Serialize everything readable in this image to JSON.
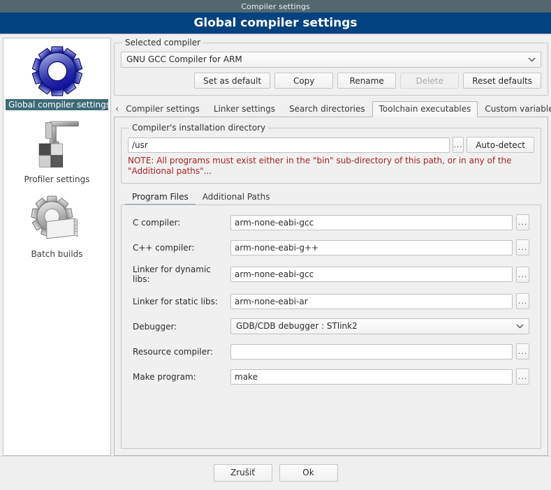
{
  "window": {
    "titlebar": "Compiler settings",
    "header": "Global compiler settings"
  },
  "sidebar": {
    "items": [
      {
        "label": "Global compiler settings",
        "icon": "blue-gear-icon",
        "selected": true
      },
      {
        "label": "Profiler settings",
        "icon": "caliper-blocks-icon",
        "selected": false
      },
      {
        "label": "Batch builds",
        "icon": "gear-pages-icon",
        "selected": false
      }
    ]
  },
  "selected_compiler": {
    "group_label": "Selected compiler",
    "combo_value": "GNU GCC Compiler for ARM",
    "buttons": [
      {
        "label": "Set as default",
        "disabled": false
      },
      {
        "label": "Copy",
        "disabled": false
      },
      {
        "label": "Rename",
        "disabled": false
      },
      {
        "label": "Delete",
        "disabled": true
      },
      {
        "label": "Reset defaults",
        "disabled": false
      }
    ]
  },
  "tabs": {
    "prev_arrow": "‹",
    "next_arrow": "›",
    "items": [
      {
        "label": "Compiler settings",
        "active": false
      },
      {
        "label": "Linker settings",
        "active": false
      },
      {
        "label": "Search directories",
        "active": false
      },
      {
        "label": "Toolchain executables",
        "active": true
      },
      {
        "label": "Custom variables",
        "active": false
      }
    ]
  },
  "install_dir": {
    "group_label": "Compiler's installation directory",
    "path_value": "/usr",
    "browse_label": "...",
    "auto_detect_label": "Auto-detect",
    "note": "NOTE: All programs must exist either in the \"bin\" sub-directory of this path, or in any of the \"Additional paths\"..."
  },
  "inner_tabs": {
    "items": [
      {
        "label": "Program Files",
        "active": true
      },
      {
        "label": "Additional Paths",
        "active": false
      }
    ]
  },
  "program_files": {
    "browse_label": "...",
    "fields": [
      {
        "label": "C compiler:",
        "value": "arm-none-eabi-gcc",
        "type": "text",
        "browse": true
      },
      {
        "label": "C++ compiler:",
        "value": "arm-none-eabi-g++",
        "type": "text",
        "browse": true
      },
      {
        "label": "Linker for dynamic libs:",
        "value": "arm-none-eabi-gcc",
        "type": "text",
        "browse": true
      },
      {
        "label": "Linker for static libs:",
        "value": "arm-none-eabi-ar",
        "type": "text",
        "browse": true
      },
      {
        "label": "Debugger:",
        "value": "GDB/CDB debugger : STlink2",
        "type": "combo",
        "browse": false
      },
      {
        "label": "Resource compiler:",
        "value": "",
        "type": "text",
        "browse": true
      },
      {
        "label": "Make program:",
        "value": "make",
        "type": "text",
        "browse": true
      }
    ]
  },
  "footer": {
    "cancel_label": "Zrušiť",
    "ok_label": "Ok"
  },
  "colors": {
    "titlebar": "#53676f",
    "header": "#034280",
    "selection": "#3d6a78",
    "note": "#aa2222",
    "window_bg": "#f0f0f0"
  }
}
